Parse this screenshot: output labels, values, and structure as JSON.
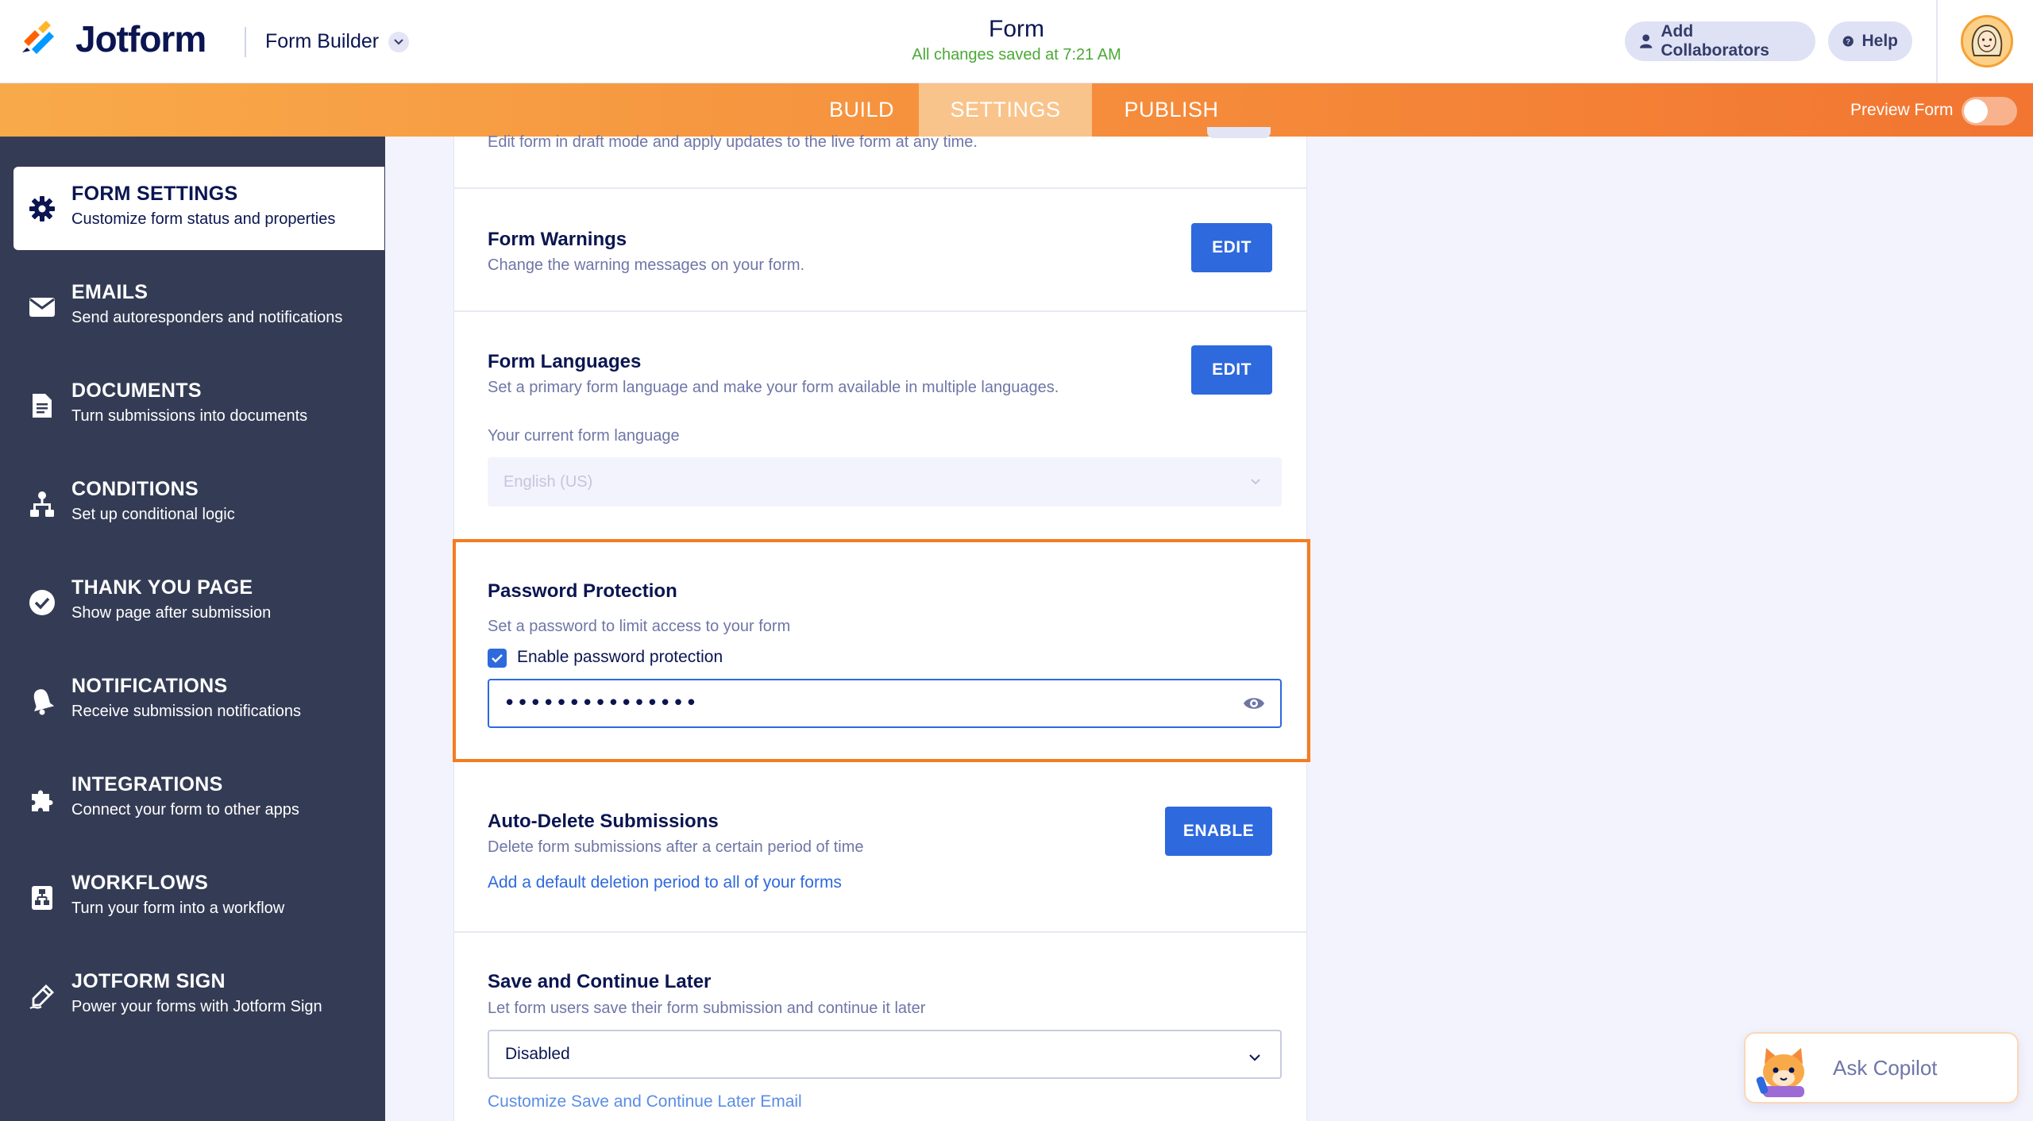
{
  "header": {
    "brand": "Jotform",
    "builder_label": "Form Builder",
    "form_title": "Form",
    "save_status": "All changes saved at 7:21 AM",
    "add_collaborators": "Add Collaborators",
    "help": "Help"
  },
  "nav": {
    "tabs": [
      {
        "label": "BUILD"
      },
      {
        "label": "SETTINGS",
        "active": true
      },
      {
        "label": "PUBLISH"
      }
    ],
    "preview_label": "Preview Form",
    "preview_on": false
  },
  "sidebar": {
    "items": [
      {
        "title": "FORM SETTINGS",
        "subtitle": "Customize form status and properties",
        "icon": "gear-icon",
        "active": true
      },
      {
        "title": "EMAILS",
        "subtitle": "Send autoresponders and notifications",
        "icon": "envelope-icon"
      },
      {
        "title": "DOCUMENTS",
        "subtitle": "Turn submissions into documents",
        "icon": "document-icon"
      },
      {
        "title": "CONDITIONS",
        "subtitle": "Set up conditional logic",
        "icon": "conditions-icon"
      },
      {
        "title": "THANK YOU PAGE",
        "subtitle": "Show page after submission",
        "icon": "check-circle-icon"
      },
      {
        "title": "NOTIFICATIONS",
        "subtitle": "Receive submission notifications",
        "icon": "bell-icon"
      },
      {
        "title": "INTEGRATIONS",
        "subtitle": "Connect your form to other apps",
        "icon": "puzzle-icon"
      },
      {
        "title": "WORKFLOWS",
        "subtitle": "Turn your form into a workflow",
        "icon": "workflow-icon"
      },
      {
        "title": "JOTFORM SIGN",
        "subtitle": "Power your forms with Jotform Sign",
        "icon": "pen-icon"
      }
    ]
  },
  "main": {
    "draft_note": "Edit form in draft mode and apply updates to the live form at any time.",
    "form_warnings": {
      "title": "Form Warnings",
      "subtitle": "Change the warning messages on your form.",
      "button": "EDIT"
    },
    "form_languages": {
      "title": "Form Languages",
      "subtitle": "Set a primary form language and make your form available in multiple languages.",
      "button": "EDIT",
      "current_label": "Your current form language",
      "current_value": "English (US)"
    },
    "password_protection": {
      "title": "Password Protection",
      "subtitle": "Set a password to limit access to your form",
      "checkbox_label": "Enable password protection",
      "checked": true,
      "masked_value": "•••••••••••••••"
    },
    "auto_delete": {
      "title": "Auto-Delete Submissions",
      "subtitle": "Delete form submissions after a certain period of time",
      "link": "Add a default deletion period to all of your forms",
      "button": "ENABLE"
    },
    "save_continue": {
      "title": "Save and Continue Later",
      "subtitle": "Let form users save their form submission and continue it later",
      "selected": "Disabled",
      "link": "Customize Save and Continue Later Email"
    }
  },
  "copilot": {
    "label": "Ask Copilot"
  },
  "colors": {
    "primary": "#2e69de",
    "accent": "#f57c1f",
    "sidebar_bg": "#343c55",
    "saved_green": "#4ba835"
  }
}
